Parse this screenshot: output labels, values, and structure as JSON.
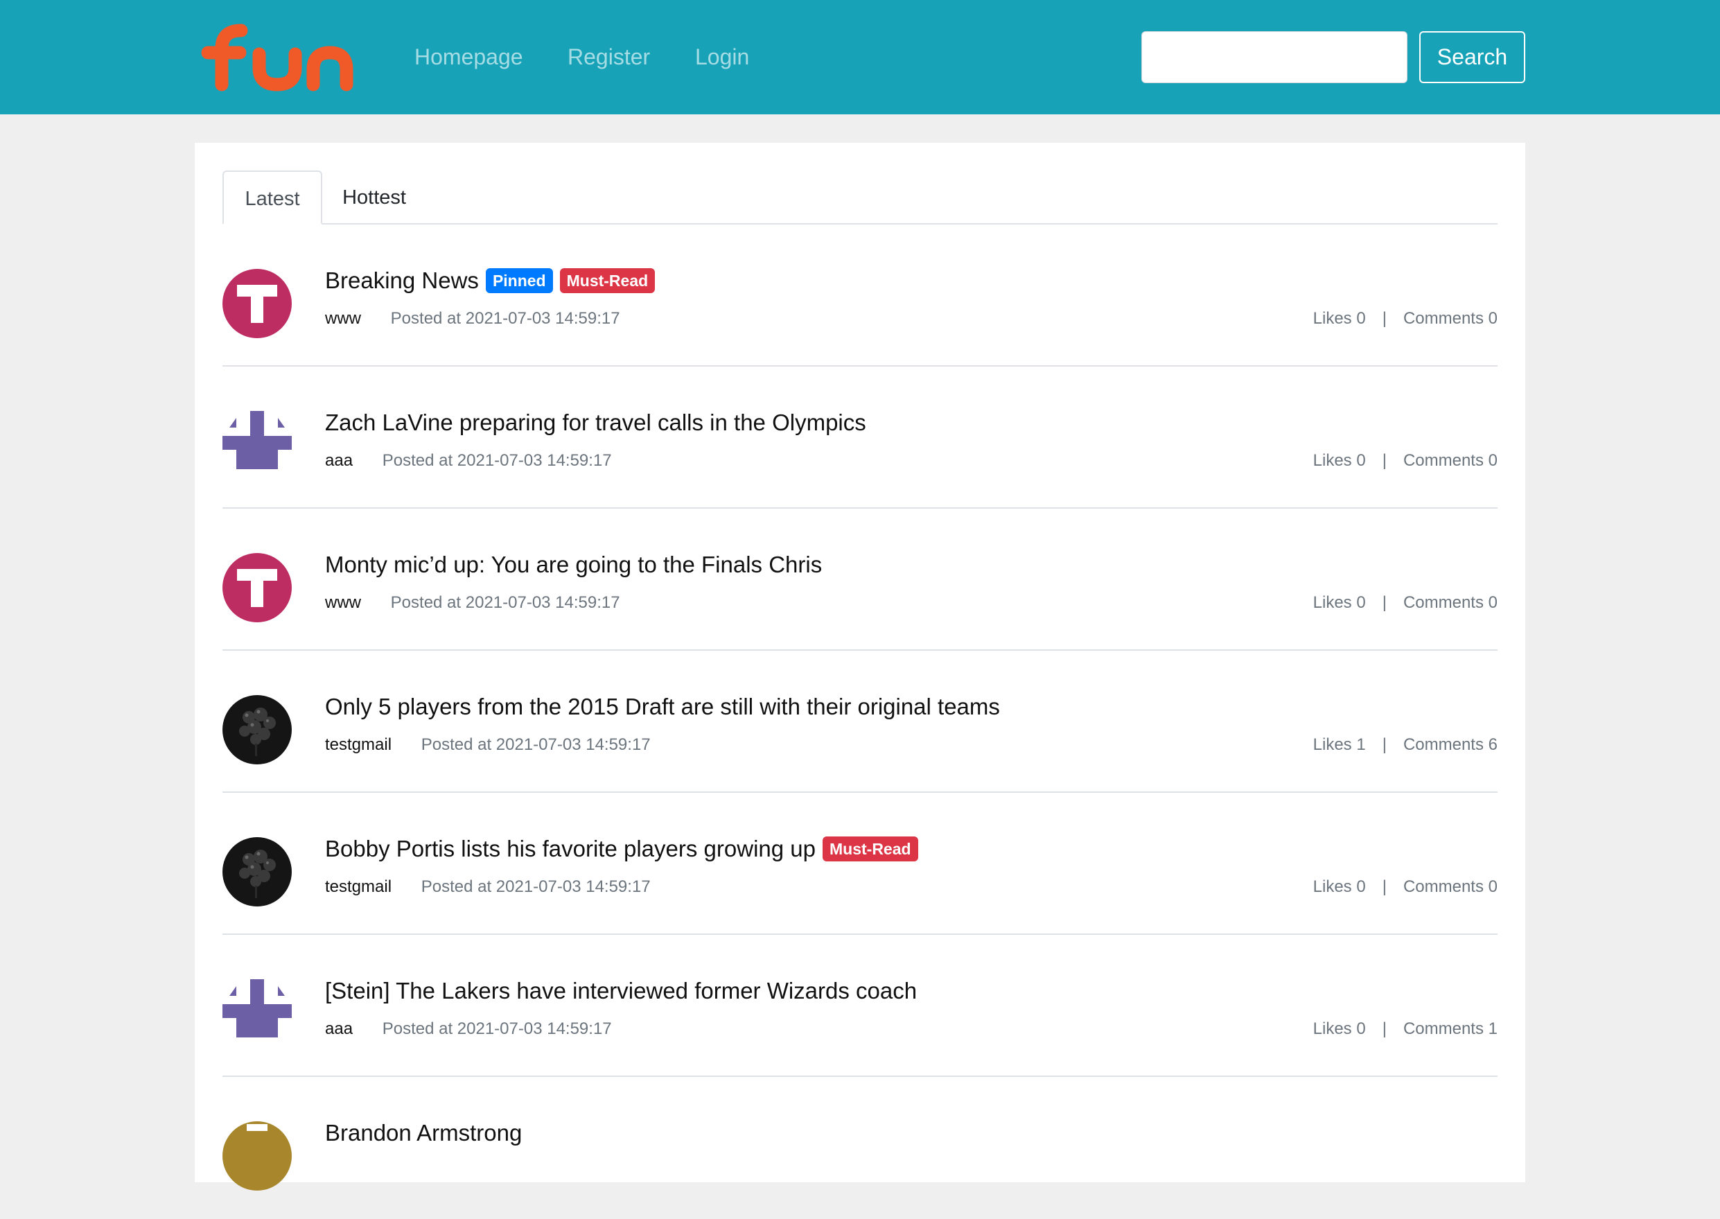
{
  "brand": {
    "logo_text": "fun",
    "color": "#f05a28"
  },
  "nav": {
    "homepage": "Homepage",
    "register": "Register",
    "login": "Login"
  },
  "search": {
    "value": "",
    "button_label": "Search"
  },
  "tabs": {
    "latest": "Latest",
    "hottest": "Hottest"
  },
  "labels": {
    "likes": "Likes",
    "comments": "Comments",
    "separator": "|"
  },
  "posts": [
    {
      "title": "Breaking News",
      "badges": [
        "Pinned",
        "Must-Read"
      ],
      "author": "www",
      "posted": "Posted at 2021-07-03 14:59:17",
      "likes": "0",
      "comments": "0",
      "avatar": "letter-t-avatar"
    },
    {
      "title": "Zach LaVine preparing for travel calls in the Olympics",
      "badges": [],
      "author": "aaa",
      "posted": "Posted at 2021-07-03 14:59:17",
      "likes": "0",
      "comments": "0",
      "avatar": "cross-pattern-avatar"
    },
    {
      "title": "Monty mic’d up: You are going to the Finals Chris",
      "badges": [],
      "author": "www",
      "posted": "Posted at 2021-07-03 14:59:17",
      "likes": "0",
      "comments": "0",
      "avatar": "letter-t-avatar"
    },
    {
      "title": "Only 5 players from the 2015 Draft are still with their original teams",
      "badges": [],
      "author": "testgmail",
      "posted": "Posted at 2021-07-03 14:59:17",
      "likes": "1",
      "comments": "6",
      "avatar": "photo-avatar"
    },
    {
      "title": "Bobby Portis lists his favorite players growing up",
      "badges": [
        "Must-Read"
      ],
      "author": "testgmail",
      "posted": "Posted at 2021-07-03 14:59:17",
      "likes": "0",
      "comments": "0",
      "avatar": "photo-avatar"
    },
    {
      "title": "[Stein] The Lakers have interviewed former Wizards coach",
      "badges": [],
      "author": "aaa",
      "posted": "Posted at 2021-07-03 14:59:17",
      "likes": "0",
      "comments": "1",
      "avatar": "cross-pattern-avatar"
    },
    {
      "title": "Brandon Armstrong",
      "badges": [],
      "author": "",
      "posted": "",
      "likes": "",
      "comments": "",
      "avatar": "partial-avatar"
    }
  ]
}
